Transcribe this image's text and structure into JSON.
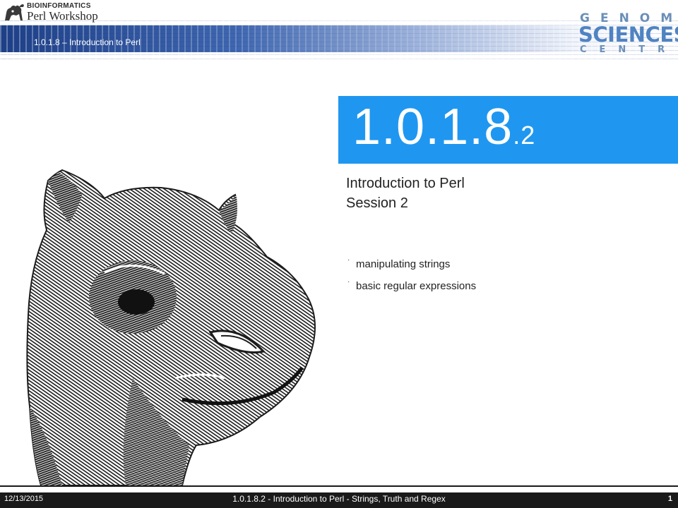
{
  "header": {
    "brand_line1": "BIOINFORMATICS",
    "brand_line2": "Perl Workshop",
    "subtitle": "1.0.1.8 – Introduction to Perl",
    "gsc_top": "GENOME",
    "gsc_mid": "SCIENCES",
    "gsc_bottom": "CENTRE"
  },
  "title": {
    "main": "1.0.1.8",
    "sub": ".2"
  },
  "subtitle_lines": [
    "Introduction to Perl",
    "Session 2"
  ],
  "bullets": [
    "manipulating strings",
    "basic regular expressions"
  ],
  "footer": {
    "date": "12/13/2015",
    "title": "1.0.1.8.2 - Introduction to Perl - Strings, Truth and Regex",
    "page": "1"
  },
  "colors": {
    "title_box": "#1f97f0",
    "banner": "#1d3f87",
    "footer": "#1a1a1a"
  },
  "images": {
    "camel": "camel-head-engraving",
    "logo": "bioinformatics-workshop-logo"
  }
}
